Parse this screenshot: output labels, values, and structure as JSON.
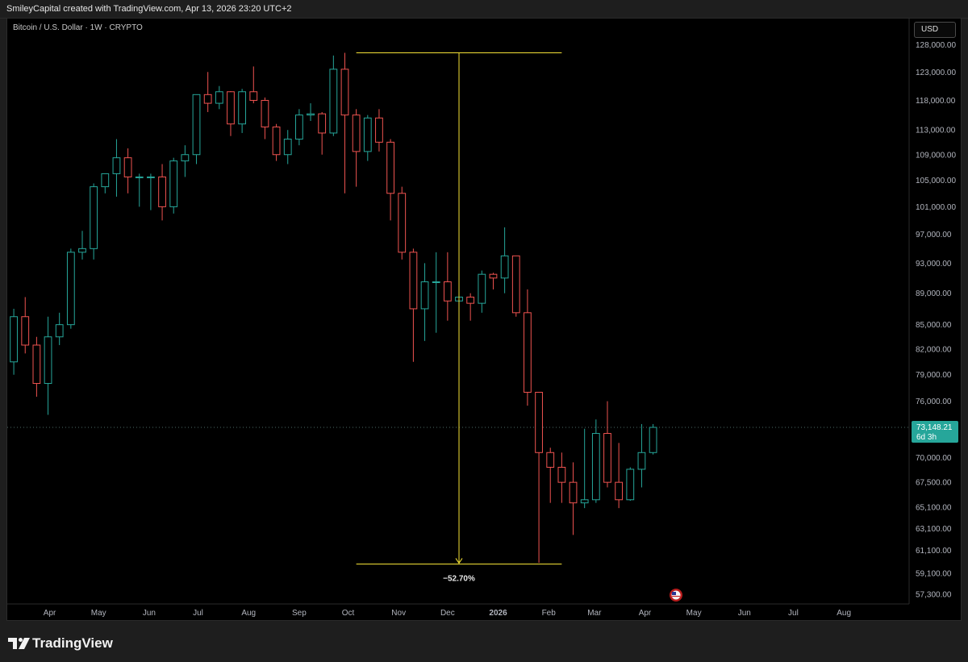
{
  "header": {
    "attribution": "SmileyCapital created with TradingView.com, Apr 13, 2026 23:20 UTC+2"
  },
  "chart": {
    "symbol_title": "Bitcoin / U.S. Dollar · 1W · CRYPTO",
    "currency_label": "USD",
    "last_price_label": "73,148.21",
    "countdown_label": "6d 3h",
    "measure_label": "−52.70%"
  },
  "footer": {
    "brand": "TradingView"
  },
  "colors": {
    "up": "#26a69a",
    "down": "#ef5350",
    "measure": "#f5e236",
    "price_tag": "#26a69a",
    "axis_text": "#b2b5be",
    "background": "#000000"
  },
  "chart_data": {
    "type": "candlestick",
    "title": "Bitcoin / U.S. Dollar · 1W · CRYPTO",
    "timeframe": "1W",
    "currency": "USD",
    "y_axis": {
      "scale": "log",
      "range": [
        56500,
        133000
      ],
      "ticks": [
        57300,
        59100,
        61100,
        63100,
        65100,
        67500,
        70000,
        76000,
        79000,
        82000,
        85000,
        89000,
        93000,
        97000,
        101000,
        105000,
        109000,
        113000,
        118000,
        123000,
        128000
      ],
      "tick_labels": [
        "57,300.00",
        "59,100.00",
        "61,100.00",
        "63,100.00",
        "65,100.00",
        "67,500.00",
        "70,000.00",
        "76,000.00",
        "79,000.00",
        "82,000.00",
        "85,000.00",
        "89,000.00",
        "93,000.00",
        "97,000.00",
        "101,000.00",
        "105,000.00",
        "109,000.00",
        "113,000.00",
        "118,000.00",
        "123,000.00",
        "128,000.00"
      ]
    },
    "x_axis": {
      "range": [
        "2025-03-06",
        "2026-09-10"
      ],
      "month_labels": [
        {
          "label": "Apr",
          "date": "2025-04-01"
        },
        {
          "label": "May",
          "date": "2025-05-01"
        },
        {
          "label": "Jun",
          "date": "2025-06-01"
        },
        {
          "label": "Jul",
          "date": "2025-07-01"
        },
        {
          "label": "Aug",
          "date": "2025-08-01"
        },
        {
          "label": "Sep",
          "date": "2025-09-01"
        },
        {
          "label": "Oct",
          "date": "2025-10-01"
        },
        {
          "label": "Nov",
          "date": "2025-11-01"
        },
        {
          "label": "Dec",
          "date": "2025-12-01"
        },
        {
          "label": "2026",
          "date": "2026-01-01",
          "bold": true
        },
        {
          "label": "Feb",
          "date": "2026-02-01"
        },
        {
          "label": "Mar",
          "date": "2026-03-01"
        },
        {
          "label": "Apr",
          "date": "2026-04-01"
        },
        {
          "label": "May",
          "date": "2026-05-01"
        },
        {
          "label": "Jun",
          "date": "2026-06-01"
        },
        {
          "label": "Jul",
          "date": "2026-07-01"
        },
        {
          "label": "Aug",
          "date": "2026-08-01"
        }
      ]
    },
    "candles": [
      {
        "date": "2025-03-10",
        "o": 80500,
        "h": 87000,
        "l": 79000,
        "c": 86000
      },
      {
        "date": "2025-03-17",
        "o": 86000,
        "h": 88500,
        "l": 81500,
        "c": 82500
      },
      {
        "date": "2025-03-24",
        "o": 82500,
        "h": 83500,
        "l": 76500,
        "c": 78000
      },
      {
        "date": "2025-03-31",
        "o": 78000,
        "h": 86000,
        "l": 74500,
        "c": 83500
      },
      {
        "date": "2025-04-07",
        "o": 83500,
        "h": 86500,
        "l": 82500,
        "c": 85000
      },
      {
        "date": "2025-04-14",
        "o": 85000,
        "h": 95000,
        "l": 84500,
        "c": 94500
      },
      {
        "date": "2025-04-21",
        "o": 94500,
        "h": 97500,
        "l": 93500,
        "c": 95000
      },
      {
        "date": "2025-04-28",
        "o": 95000,
        "h": 104500,
        "l": 93500,
        "c": 104000
      },
      {
        "date": "2025-05-05",
        "o": 104000,
        "h": 106000,
        "l": 103000,
        "c": 106000
      },
      {
        "date": "2025-05-12",
        "o": 106000,
        "h": 111500,
        "l": 102500,
        "c": 108500
      },
      {
        "date": "2025-05-19",
        "o": 108500,
        "h": 110000,
        "l": 103000,
        "c": 105500
      },
      {
        "date": "2025-05-26",
        "o": 105500,
        "h": 106000,
        "l": 101000,
        "c": 105500
      },
      {
        "date": "2025-06-02",
        "o": 105500,
        "h": 106000,
        "l": 100500,
        "c": 105500
      },
      {
        "date": "2025-06-09",
        "o": 105500,
        "h": 107500,
        "l": 99000,
        "c": 101000
      },
      {
        "date": "2025-06-16",
        "o": 101000,
        "h": 108500,
        "l": 100000,
        "c": 108000
      },
      {
        "date": "2025-06-23",
        "o": 108000,
        "h": 110500,
        "l": 105500,
        "c": 109000
      },
      {
        "date": "2025-06-30",
        "o": 109000,
        "h": 119000,
        "l": 107500,
        "c": 119000
      },
      {
        "date": "2025-07-07",
        "o": 119000,
        "h": 123000,
        "l": 116000,
        "c": 117500
      },
      {
        "date": "2025-07-14",
        "o": 117500,
        "h": 120500,
        "l": 116500,
        "c": 119500
      },
      {
        "date": "2025-07-21",
        "o": 119500,
        "h": 119600,
        "l": 112000,
        "c": 114000
      },
      {
        "date": "2025-07-28",
        "o": 114000,
        "h": 120000,
        "l": 112500,
        "c": 119500
      },
      {
        "date": "2025-08-04",
        "o": 119500,
        "h": 124000,
        "l": 117500,
        "c": 118000
      },
      {
        "date": "2025-08-11",
        "o": 118000,
        "h": 118500,
        "l": 111500,
        "c": 113500
      },
      {
        "date": "2025-08-18",
        "o": 113500,
        "h": 114000,
        "l": 108000,
        "c": 109000
      },
      {
        "date": "2025-08-25",
        "o": 109000,
        "h": 113000,
        "l": 107500,
        "c": 111500
      },
      {
        "date": "2025-09-01",
        "o": 111500,
        "h": 116500,
        "l": 110500,
        "c": 115500
      },
      {
        "date": "2025-09-08",
        "o": 115500,
        "h": 117500,
        "l": 114500,
        "c": 115700
      },
      {
        "date": "2025-09-15",
        "o": 115700,
        "h": 116000,
        "l": 109000,
        "c": 112500
      },
      {
        "date": "2025-09-22",
        "o": 112500,
        "h": 126000,
        "l": 112000,
        "c": 123500
      },
      {
        "date": "2025-09-29",
        "o": 123500,
        "h": 126500,
        "l": 103000,
        "c": 115500
      },
      {
        "date": "2025-10-06",
        "o": 115500,
        "h": 116500,
        "l": 104000,
        "c": 109500
      },
      {
        "date": "2025-10-13",
        "o": 109500,
        "h": 115500,
        "l": 108000,
        "c": 115000
      },
      {
        "date": "2025-10-20",
        "o": 115000,
        "h": 116500,
        "l": 109500,
        "c": 111000
      },
      {
        "date": "2025-10-27",
        "o": 111000,
        "h": 111500,
        "l": 99000,
        "c": 103000
      },
      {
        "date": "2025-11-03",
        "o": 103000,
        "h": 104000,
        "l": 93500,
        "c": 94500
      },
      {
        "date": "2025-11-10",
        "o": 94500,
        "h": 95000,
        "l": 80500,
        "c": 87000
      },
      {
        "date": "2025-11-17",
        "o": 87000,
        "h": 93000,
        "l": 83000,
        "c": 90500
      },
      {
        "date": "2025-11-24",
        "o": 90500,
        "h": 94500,
        "l": 84000,
        "c": 90500
      },
      {
        "date": "2025-12-01",
        "o": 90500,
        "h": 94500,
        "l": 85500,
        "c": 88000
      },
      {
        "date": "2025-12-08",
        "o": 88000,
        "h": 89500,
        "l": 84000,
        "c": 88500
      },
      {
        "date": "2025-12-15",
        "o": 88500,
        "h": 89000,
        "l": 85500,
        "c": 87700
      },
      {
        "date": "2025-12-22",
        "o": 87700,
        "h": 92000,
        "l": 86500,
        "c": 91500
      },
      {
        "date": "2025-12-29",
        "o": 91500,
        "h": 91700,
        "l": 89500,
        "c": 91000
      },
      {
        "date": "2026-01-05",
        "o": 91000,
        "h": 98000,
        "l": 89000,
        "c": 94000
      },
      {
        "date": "2026-01-12",
        "o": 94000,
        "h": 94000,
        "l": 86000,
        "c": 86500
      },
      {
        "date": "2026-01-19",
        "o": 86500,
        "h": 89500,
        "l": 75500,
        "c": 77000
      },
      {
        "date": "2026-01-26",
        "o": 77000,
        "h": 77000,
        "l": 60000,
        "c": 70500
      },
      {
        "date": "2026-02-02",
        "o": 70500,
        "h": 71000,
        "l": 65500,
        "c": 69000
      },
      {
        "date": "2026-02-09",
        "o": 69000,
        "h": 70500,
        "l": 65500,
        "c": 67500
      },
      {
        "date": "2026-02-16",
        "o": 67500,
        "h": 69500,
        "l": 62500,
        "c": 65500
      },
      {
        "date": "2026-02-23",
        "o": 65500,
        "h": 73000,
        "l": 65000,
        "c": 65800
      },
      {
        "date": "2026-03-02",
        "o": 65800,
        "h": 74000,
        "l": 65500,
        "c": 72500
      },
      {
        "date": "2026-03-09",
        "o": 72500,
        "h": 76000,
        "l": 67000,
        "c": 67500
      },
      {
        "date": "2026-03-16",
        "o": 67500,
        "h": 71500,
        "l": 65000,
        "c": 65800
      },
      {
        "date": "2026-03-23",
        "o": 65800,
        "h": 69000,
        "l": 65700,
        "c": 68800
      },
      {
        "date": "2026-03-30",
        "o": 68800,
        "h": 73500,
        "l": 67000,
        "c": 70500
      },
      {
        "date": "2026-04-06",
        "o": 70500,
        "h": 73500,
        "l": 70300,
        "c": 73148
      }
    ],
    "last_price": 73148.21,
    "measure": {
      "from_price": 126500,
      "to_price": 59900,
      "start_date": "2025-10-06",
      "end_date": "2026-02-09",
      "change_label": "−52.70%"
    }
  }
}
